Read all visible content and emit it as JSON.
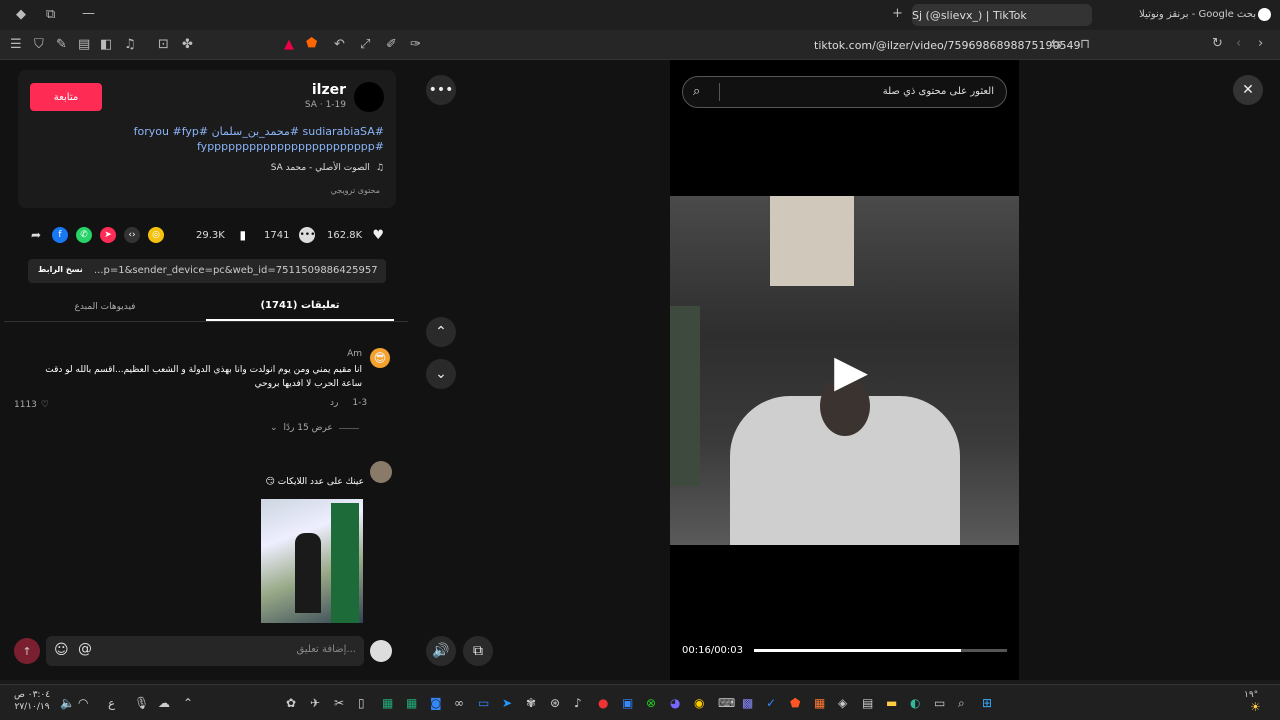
{
  "browser": {
    "right_tab_title": "بحث Google - برنقز ونوتيلا",
    "active_tab_title": "Sj (@slievx_) | TikTok",
    "url": "tiktok.com/@ilzer/video/7596986898875190549"
  },
  "post": {
    "username": "ilzer",
    "meta": "1-19 · SA",
    "follow_label": "متابعة",
    "hashtags_line1": "#sudiarabiaSA #محمد_بن_سلمان #foryou #fyp",
    "hashtags_line2": "#fypppppppppppppppppppppppp",
    "sound": "الصوت الأصلي - محمد SA",
    "promo": "محتوى ترويجي",
    "likes": "162.8K",
    "comments_count": "1741",
    "saves": "29.3K",
    "link_text": "...p=1&sender_device=pc&web_id=7511509886425957896",
    "copy_link_label": "نسخ الرابط"
  },
  "tabs": {
    "comments_tab": "تعليقات (1741)",
    "creator_videos_tab": "فيديوهات المبدع"
  },
  "comments": [
    {
      "author": "Am",
      "text_line1": "انا مقيم يمني ومن يوم انولدت وانا بهذي الدولة و الشعب العظيم...اقسم بالله لو دقت",
      "text_line2": "ساعة الحرب لا افديها بروحي",
      "date": "1-3",
      "reply_label": "رد",
      "likes": "1113",
      "view_replies": "عرض 15 ردًا"
    },
    {
      "author": "",
      "text": "عينك على عدد اللايكات 😏"
    }
  ],
  "composer": {
    "placeholder": "إضافة تعليق..."
  },
  "video": {
    "search_placeholder": "العثور على محتوى ذي صلة",
    "time": "00:16/00:03",
    "progress": 0.82
  },
  "taskbar": {
    "time": "٠٣:٠٤ ص",
    "date": "٢٧/١٠/١٩",
    "lang": "ع",
    "temp": "١٩°"
  },
  "icons": [
    "search-icon",
    "close-icon",
    "more-icon",
    "chevron-up-icon",
    "chevron-down-icon",
    "volume-icon",
    "heart-icon",
    "comment-icon",
    "bookmark-icon",
    "share-icon",
    "play-icon"
  ]
}
